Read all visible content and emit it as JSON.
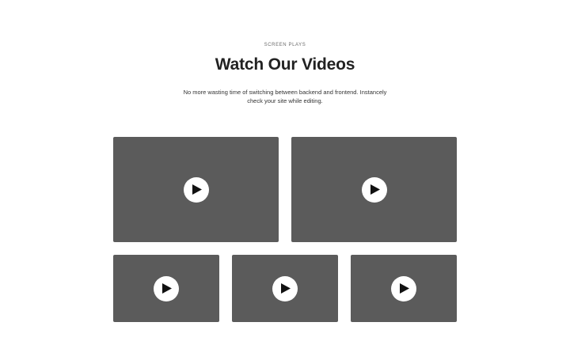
{
  "section": {
    "eyebrow": "SCREEN PLAYS",
    "title": "Watch Our Videos",
    "subtitle": "No more wasting time of switching between backend and frontend. Instancely check your site while editing."
  },
  "videos": [
    {
      "icon": "play-icon"
    },
    {
      "icon": "play-icon"
    },
    {
      "icon": "play-icon"
    },
    {
      "icon": "play-icon"
    },
    {
      "icon": "play-icon"
    }
  ],
  "colors": {
    "background": "#ffffff",
    "video_placeholder": "#5b5b5b",
    "play_button": "#ffffff",
    "play_glyph": "#111111"
  }
}
